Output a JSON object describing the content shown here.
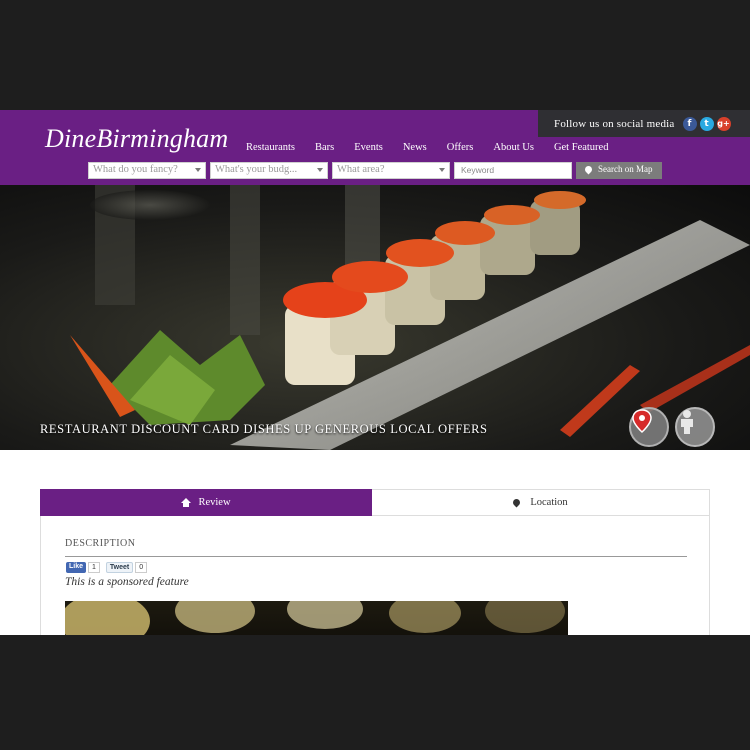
{
  "header": {
    "logo": "DineBirmingham",
    "social_label": "Follow us on social media",
    "social_icons": [
      "facebook-icon",
      "twitter-icon",
      "google-plus-icon"
    ],
    "nav": [
      "Restaurants",
      "Bars",
      "Events",
      "News",
      "Offers",
      "About Us",
      "Get Featured"
    ]
  },
  "filters": {
    "fancy_placeholder": "What do you fancy?",
    "budget_placeholder": "What's your budg...",
    "area_placeholder": "What area?",
    "keyword_placeholder": "Keyword",
    "map_button": "Search on Map"
  },
  "hero": {
    "caption": "RESTAURANT DISCOUNT CARD DISHES UP GENEROUS LOCAL OFFERS"
  },
  "tabs": {
    "review": "Review",
    "location": "Location"
  },
  "article": {
    "description_heading": "DESCRIPTION",
    "like_label": "Like",
    "like_count": "1",
    "tweet_label": "Tweet",
    "tweet_count": "0",
    "sponsored_note": "This is a sponsored feature"
  },
  "colors": {
    "brand_purple": "#6a1f84",
    "social_bar": "#2f2f33",
    "map_button": "#7c7c7c"
  }
}
